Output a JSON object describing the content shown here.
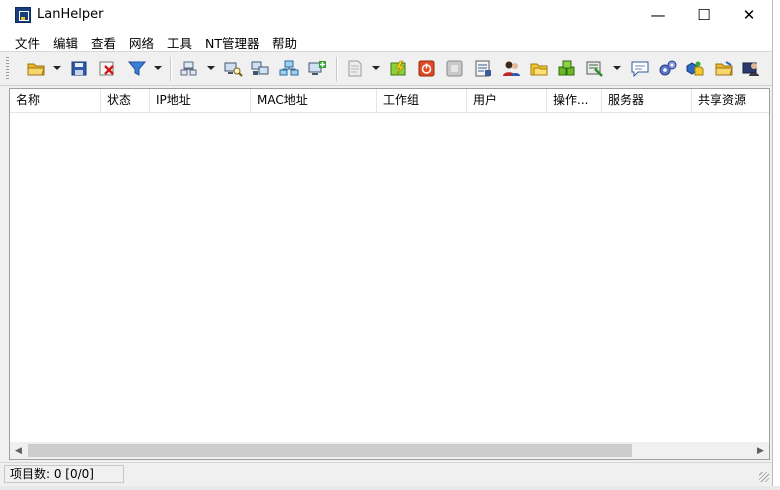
{
  "window": {
    "title": "LanHelper",
    "minimize": "—",
    "maximize": "☐",
    "close": "✕"
  },
  "menu": [
    "文件",
    "编辑",
    "查看",
    "网络",
    "工具",
    "NT管理器",
    "帮助"
  ],
  "toolbar": {
    "icons": [
      "open-folder-icon",
      "save-icon",
      "delete-icon",
      "filter-icon",
      "scan-network-icon",
      "computer-search-icon",
      "scan-computers-icon",
      "network-group-icon",
      "add-computer-icon",
      "document-icon",
      "refresh-icon",
      "power-off-icon",
      "block-icon",
      "message-log-icon",
      "users-icon",
      "shared-folders-icon",
      "share-green-icon",
      "cleanup-icon",
      "chat-icon",
      "settings-gears-icon",
      "remote-folder-icon",
      "open-share-icon",
      "user-admin-icon"
    ]
  },
  "columns": [
    "名称",
    "状态",
    "IP地址",
    "MAC地址",
    "工作组",
    "用户",
    "操作...",
    "服务器",
    "共享资源"
  ],
  "rows": [],
  "status": {
    "item_count": "项目数: 0 [0/0]"
  }
}
